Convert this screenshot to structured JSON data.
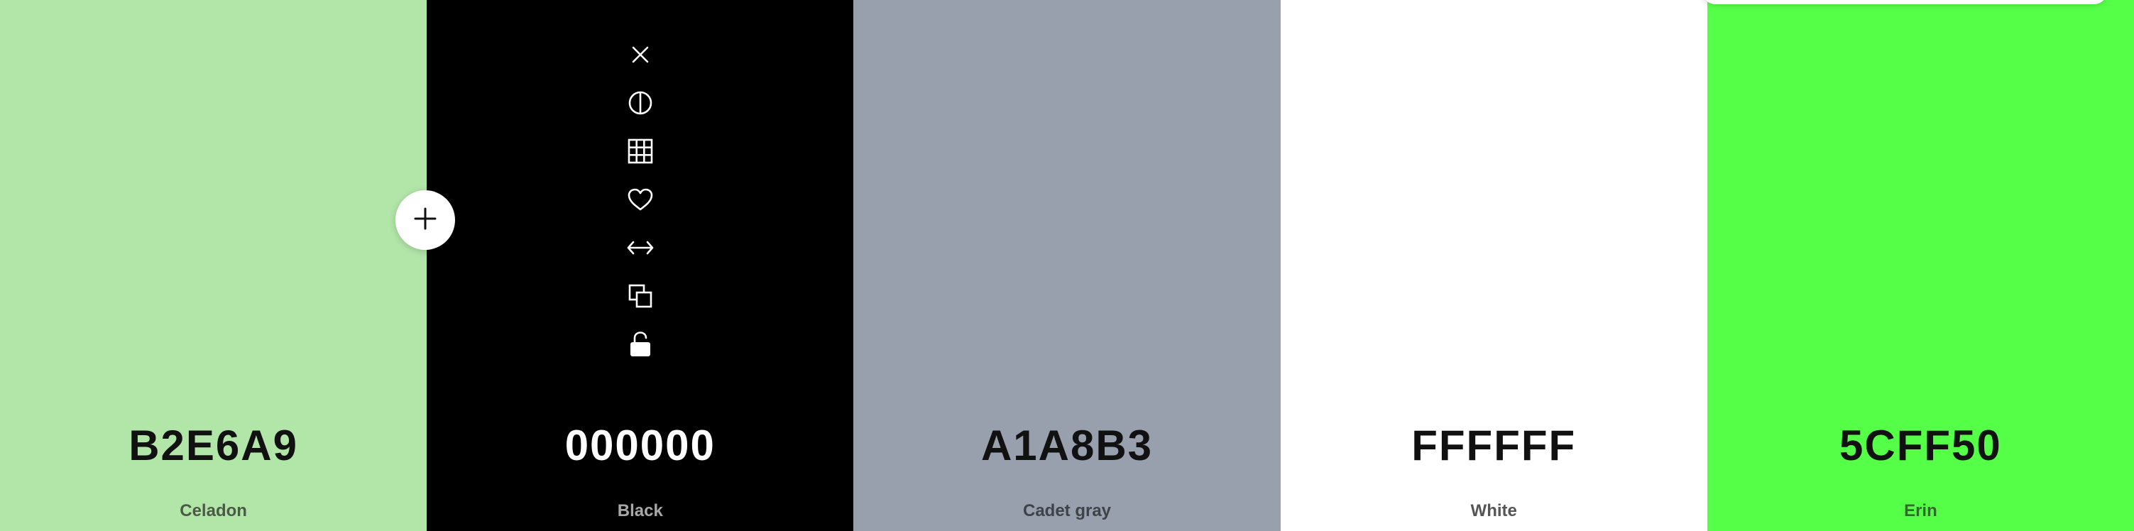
{
  "palette": {
    "swatches": [
      {
        "hex": "B2E6A9",
        "name": "Celadon",
        "color": "#B2E6A9",
        "text_color": "#111111",
        "name_color": "#4a5a47"
      },
      {
        "hex": "000000",
        "name": "Black",
        "color": "#000000",
        "text_color": "#ffffff",
        "name_color": "#a8a8a8"
      },
      {
        "hex": "A1A8B3",
        "name": "Cadet gray",
        "color": "#98A0AD",
        "text_color": "#111111",
        "name_color": "#3e434a"
      },
      {
        "hex": "FFFFFF",
        "name": "White",
        "color": "#FFFFFF",
        "text_color": "#111111",
        "name_color": "#555555"
      },
      {
        "hex": "5CFF50",
        "name": "Erin",
        "color": "#55FF48",
        "text_color": "#111111",
        "name_color": "#2e6a28"
      }
    ]
  },
  "toolbar": {
    "icons": [
      "close-icon",
      "contrast-icon",
      "grid-icon",
      "heart-icon",
      "arrows-horizontal-icon",
      "copy-icon",
      "unlock-icon"
    ]
  },
  "add_button": {
    "icon": "plus-icon"
  }
}
